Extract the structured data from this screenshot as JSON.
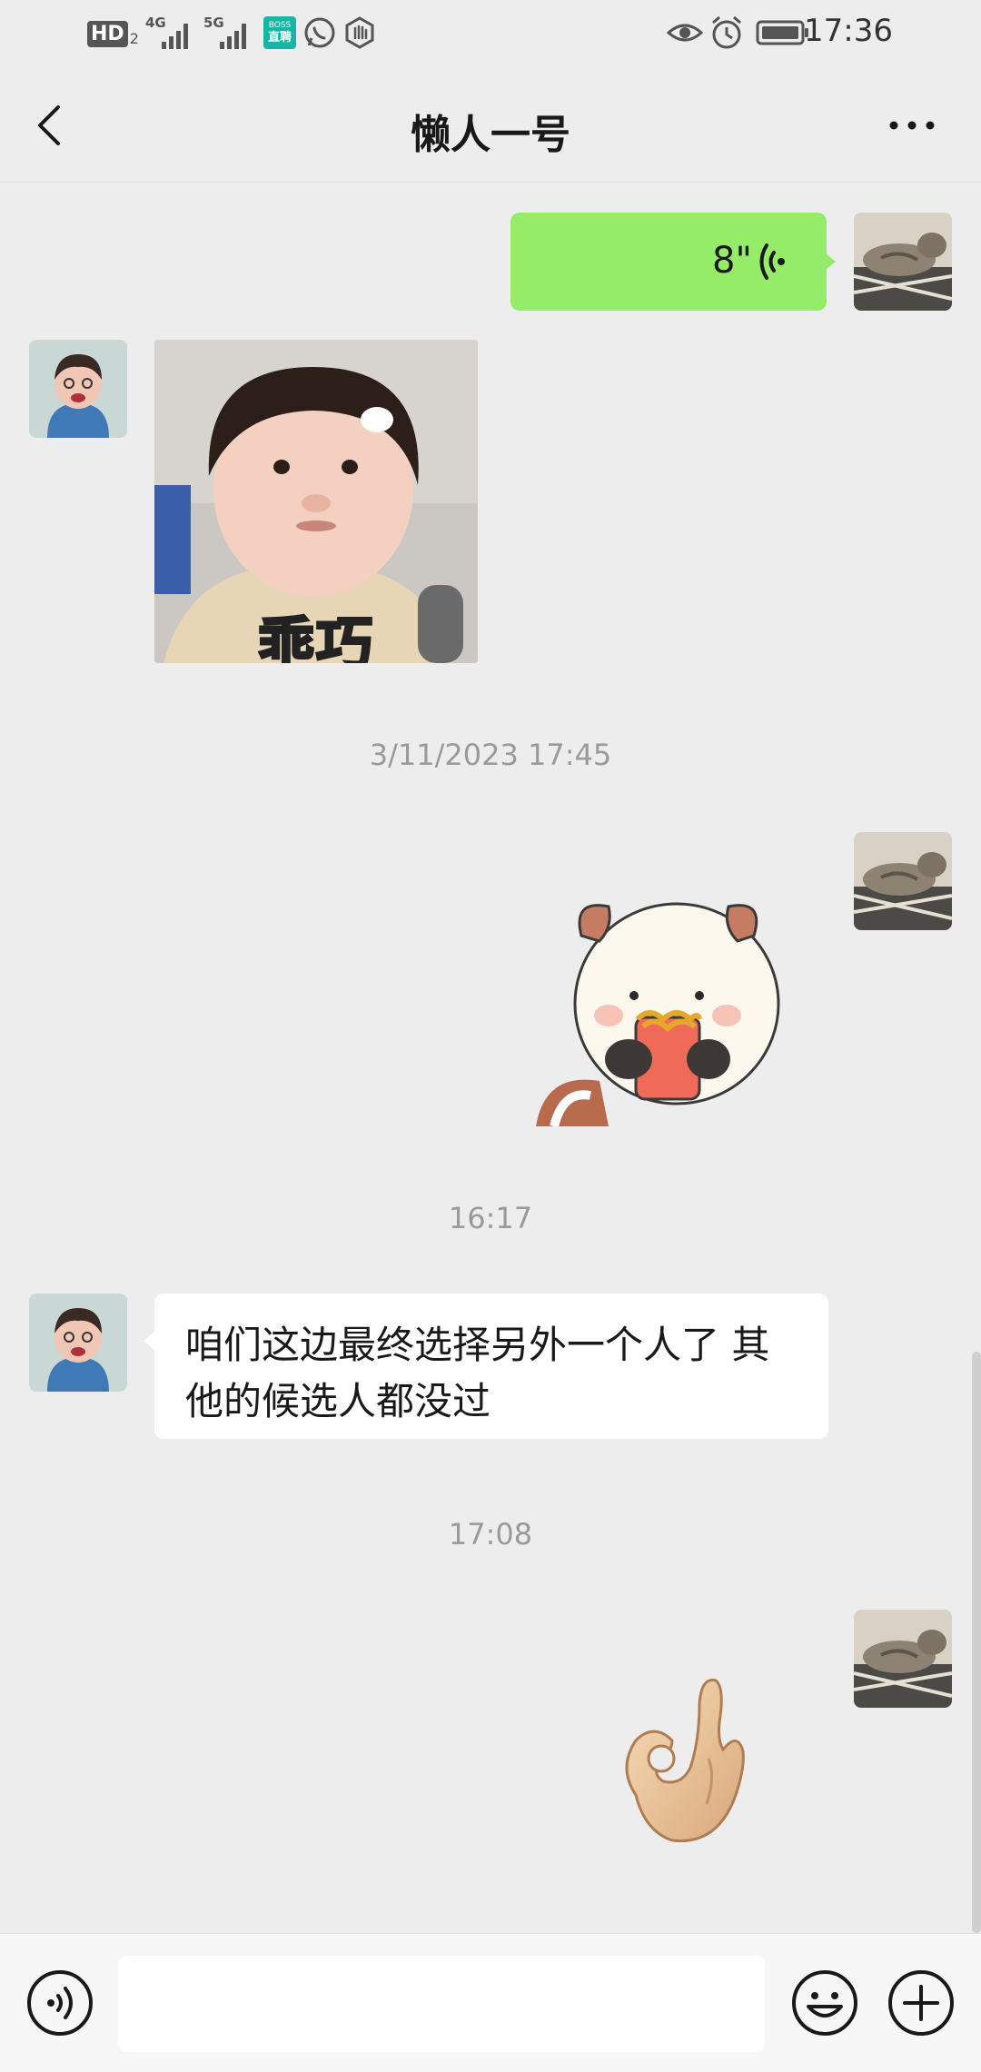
{
  "status_bar": {
    "hd_label": "HD",
    "hd_sub": "2",
    "net1": "4G",
    "net2": "5G",
    "boss_top": "BOSS",
    "boss_bottom": "直聘",
    "time": "17:36"
  },
  "header": {
    "title": "懒人一号"
  },
  "messages": {
    "voice_duration": "8\"",
    "sticker_baby_caption": "乖巧",
    "time_1": "3/11/2023 17:45",
    "time_2": "16:17",
    "text_message": "咱们这边最终选择另外一个人了 其他的候选人都没过",
    "time_3": "17:08"
  },
  "colors": {
    "background": "#ededed",
    "voice_bubble": "#95ec69",
    "text_bubble": "#ffffff"
  },
  "icons": [
    "back-icon",
    "more-icon",
    "voice-wave-icon",
    "voice-toggle-icon",
    "emoji-icon",
    "plus-icon",
    "eye-icon",
    "alarm-icon",
    "battery-icon",
    "whatsapp-icon",
    "hand-icon"
  ]
}
